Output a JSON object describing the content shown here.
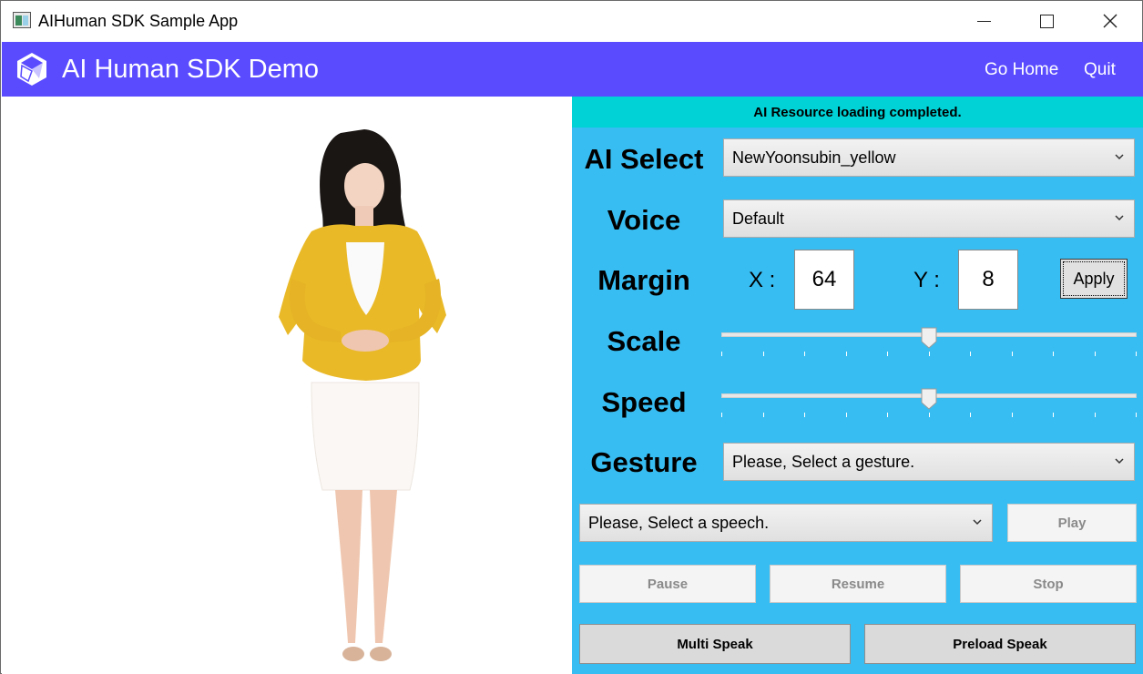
{
  "window": {
    "title": "AIHuman SDK Sample App",
    "controls": {
      "minimize_icon": "minimize-icon",
      "maximize_icon": "maximize-icon",
      "close_icon": "close-icon"
    }
  },
  "appbar": {
    "logo_icon": "cube-logo-icon",
    "title": "AI Human SDK Demo",
    "nav": {
      "home": "Go Home",
      "quit": "Quit"
    },
    "color": "#5a4bff"
  },
  "panel": {
    "status": "AI Resource loading completed.",
    "status_color": "#00d2d6",
    "background": "#38bdf2",
    "ai_select": {
      "label": "AI Select",
      "value": "NewYoonsubin_yellow"
    },
    "voice": {
      "label": "Voice",
      "value": "Default"
    },
    "margin": {
      "label": "Margin",
      "x_label": "X :",
      "x_value": "64",
      "y_label": "Y :",
      "y_value": "8",
      "apply": "Apply"
    },
    "scale": {
      "label": "Scale",
      "value_fraction": 0.5,
      "ticks": 11
    },
    "speed": {
      "label": "Speed",
      "value_fraction": 0.5,
      "ticks": 11
    },
    "gesture": {
      "label": "Gesture",
      "value": "Please, Select a gesture."
    },
    "speech": {
      "value": "Please, Select a speech."
    },
    "buttons": {
      "play": "Play",
      "pause": "Pause",
      "resume": "Resume",
      "stop": "Stop",
      "multi_speak": "Multi Speak",
      "preload_speak": "Preload Speak"
    }
  },
  "avatar": {
    "description_icon": "ai-human-avatar"
  }
}
